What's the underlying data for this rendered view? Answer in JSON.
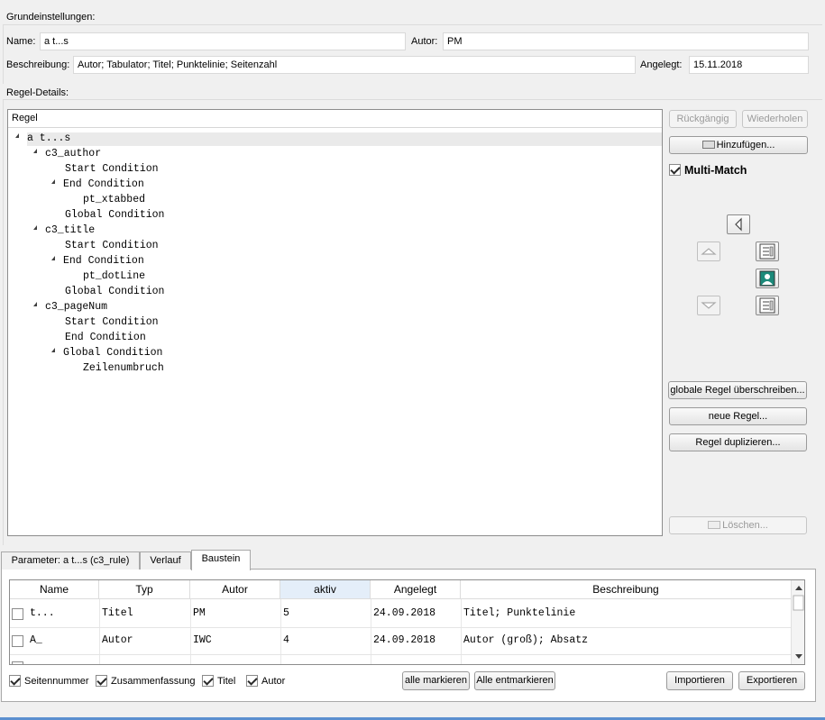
{
  "basic": {
    "group_label": "Grundeinstellungen:",
    "name_label": "Name:",
    "name_value": "a t...s",
    "author_label": "Autor:",
    "author_value": "PM",
    "description_label": "Beschreibung:",
    "description_value": "Autor; Tabulator; Titel; Punktelinie; Seitenzahl",
    "created_label": "Angelegt:",
    "created_value": "15.11.2018"
  },
  "rule_details": {
    "group_label": "Regel-Details:",
    "tree_header": "Regel",
    "tree": [
      {
        "text": "a t...s",
        "expanded": true
      },
      {
        "text": "c3_author",
        "expanded": true
      },
      {
        "text": "Start Condition"
      },
      {
        "text": "End Condition",
        "expanded": true
      },
      {
        "text": "pt_xtabbed"
      },
      {
        "text": "Global Condition"
      },
      {
        "text": "c3_title",
        "expanded": true
      },
      {
        "text": "Start Condition"
      },
      {
        "text": "End Condition",
        "expanded": true
      },
      {
        "text": "pt_dotLine"
      },
      {
        "text": "Global Condition"
      },
      {
        "text": "c3_pageNum",
        "expanded": true
      },
      {
        "text": "Start Condition"
      },
      {
        "text": "End Condition"
      },
      {
        "text": "Global Condition",
        "expanded": true
      },
      {
        "text": "Zeilenumbruch"
      }
    ]
  },
  "side": {
    "undo": "Rückgängig",
    "redo": "Wiederholen",
    "add": "Hinzufügen...",
    "multi_match": "Multi-Match",
    "override_global": "globale Regel überschreiben...",
    "new_rule": "neue Regel...",
    "duplicate_rule": "Regel duplizieren...",
    "delete": "Löschen..."
  },
  "tabs": [
    "Parameter: a t...s (c3_rule)",
    "Verlauf",
    "Baustein"
  ],
  "active_tab": "Baustein",
  "table": {
    "columns": [
      "Name",
      "Typ",
      "Autor",
      "aktiv",
      "Angelegt",
      "Beschreibung"
    ],
    "rows": [
      {
        "name": "t...",
        "typ": "Titel",
        "autor": "PM",
        "aktiv": "5",
        "angelegt": "24.09.2018",
        "beschreibung": "Titel; Punktelinie"
      },
      {
        "name": "A_",
        "typ": "Autor",
        "autor": "IWC",
        "aktiv": "4",
        "angelegt": "24.09.2018",
        "beschreibung": "Autor (groß); Absatz"
      }
    ]
  },
  "filters": {
    "page_numbers": "Seitennummer",
    "summary": "Zusammenfassung",
    "title": "Titel",
    "author": "Autor"
  },
  "bottom_buttons": {
    "mark_all": "alle markieren",
    "unmark_all": "Alle entmarkieren",
    "import": "Importieren",
    "export": "Exportieren"
  }
}
